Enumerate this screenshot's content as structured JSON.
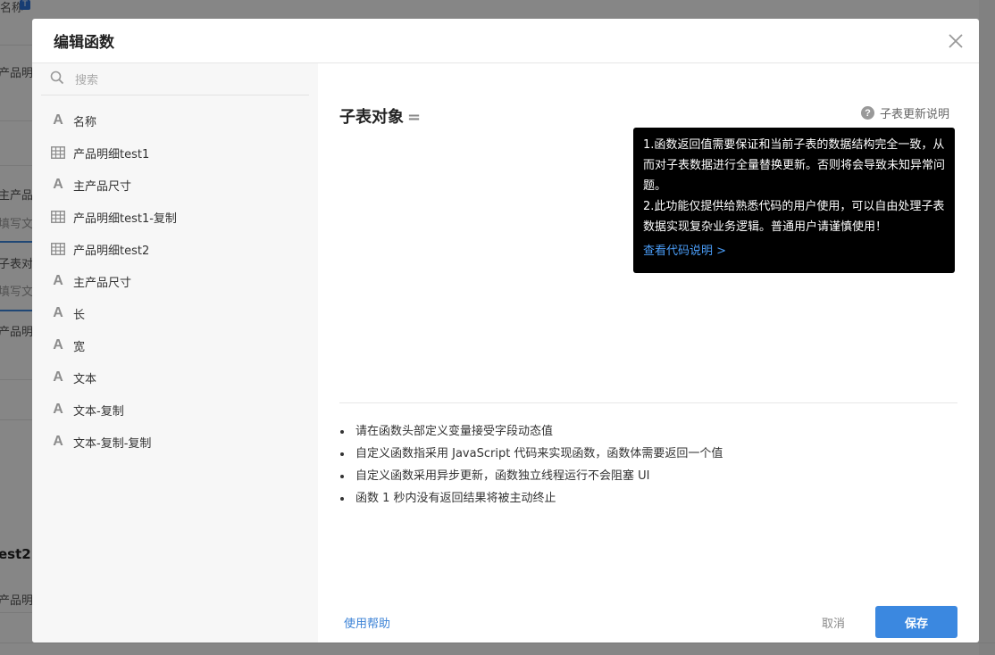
{
  "background": {
    "fragments": [
      "名称",
      "产品明细",
      "主产品尺",
      "填写文本",
      "子表对象",
      "填写文本",
      "产品明细",
      "est2",
      "产品明细"
    ],
    "badge": "T"
  },
  "dialog": {
    "title": "编辑函数",
    "close_icon": "close-icon"
  },
  "sidebar": {
    "search_placeholder": "搜索",
    "fields": [
      {
        "label": "名称",
        "icon": "text"
      },
      {
        "label": "产品明细test1",
        "icon": "table"
      },
      {
        "label": "主产品尺寸",
        "icon": "text"
      },
      {
        "label": "产品明细test1-复制",
        "icon": "table"
      },
      {
        "label": "产品明细test2",
        "icon": "table"
      },
      {
        "label": "主产品尺寸",
        "icon": "text"
      },
      {
        "label": "长",
        "icon": "text"
      },
      {
        "label": "宽",
        "icon": "text"
      },
      {
        "label": "文本",
        "icon": "text"
      },
      {
        "label": "文本-复制",
        "icon": "text"
      },
      {
        "label": "文本-复制-复制",
        "icon": "text"
      }
    ]
  },
  "main": {
    "formula_label": "子表对象",
    "formula_eq": "=",
    "help_link": "子表更新说明",
    "tooltip": {
      "line1": "1.函数返回值需要保证和当前子表的数据结构完全一致，从而对子表数据进行全量替换更新。否则将会导致未知异常问题。",
      "line2": "2.此功能仅提供给熟悉代码的用户使用，可以自由处理子表数据实现复杂业务逻辑。普通用户请谨慎使用！",
      "link": "查看代码说明 >"
    },
    "notes": [
      "请在函数头部定义变量接受字段动态值",
      "自定义函数指采用 JavaScript 代码来实现函数，函数体需要返回一个值",
      "自定义函数采用异步更新，函数独立线程运行不会阻塞 UI",
      "函数 1 秒内没有返回结果将被主动终止"
    ]
  },
  "footer": {
    "help": "使用帮助",
    "cancel": "取消",
    "save": "保存"
  },
  "colors": {
    "accent": "#3b88e0",
    "link": "#3b82d6",
    "tooltip_bg": "#000000"
  }
}
